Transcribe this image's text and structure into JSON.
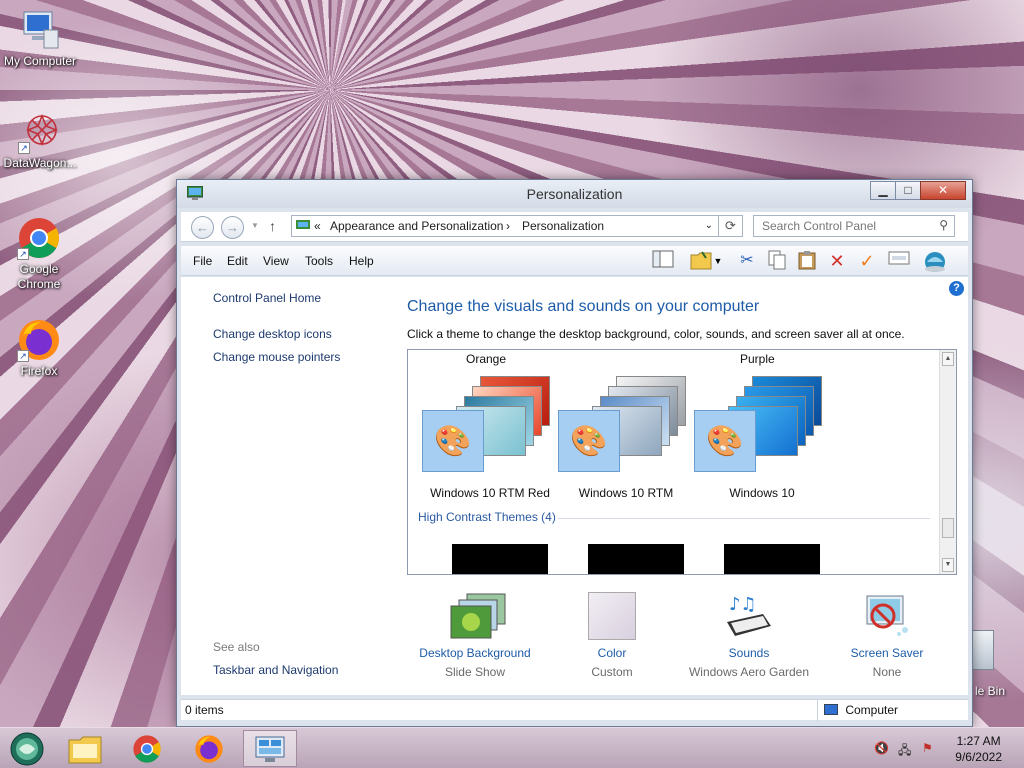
{
  "desktop": {
    "icons": [
      {
        "label": "My Computer"
      },
      {
        "label": "DataWagon..."
      },
      {
        "label": "Google Chrome"
      },
      {
        "label": "Firefox"
      }
    ],
    "recycle_partial_label": "le Bin"
  },
  "window": {
    "title": "Personalization",
    "address": {
      "overflow": "«",
      "crumbs": [
        "Appearance and Personalization",
        "Personalization"
      ],
      "separator": "›"
    },
    "search_placeholder": "Search Control Panel",
    "menu": [
      "File",
      "Edit",
      "View",
      "Tools",
      "Help"
    ],
    "left_links": [
      "Control Panel Home",
      "Change desktop icons",
      "Change mouse pointers"
    ],
    "see_also": {
      "header": "See also",
      "links": [
        "Taskbar and Navigation"
      ]
    },
    "heading": "Change the visuals and sounds on your computer",
    "subtext": "Click a theme to change the desktop background, color, sounds, and screen saver all at once.",
    "theme_top_labels": [
      "Orange",
      "Purple"
    ],
    "themes": [
      {
        "label": "Windows 10 RTM Red"
      },
      {
        "label": "Windows 10 RTM"
      },
      {
        "label": "Windows 10"
      }
    ],
    "high_contrast_title": "High Contrast Themes (4)",
    "bottom": [
      {
        "label": "Desktop Background",
        "value": "Slide Show"
      },
      {
        "label": "Color",
        "value": "Custom"
      },
      {
        "label": "Sounds",
        "value": "Windows Aero Garden"
      },
      {
        "label": "Screen Saver",
        "value": "None"
      }
    ],
    "status": {
      "items": "0 items",
      "location": "Computer"
    }
  },
  "taskbar": {
    "time": "1:27 AM",
    "date": "9/6/2022"
  },
  "colors": {
    "link_blue": "#1e5ca8",
    "heading_blue": "#1e5ca8",
    "close_red": "#c8452f"
  }
}
